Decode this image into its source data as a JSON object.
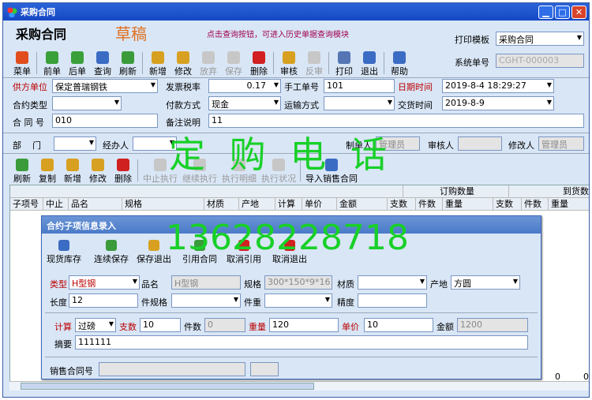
{
  "window": {
    "title": "采购合同"
  },
  "header": {
    "title": "采购合同",
    "draft": "草稿",
    "hint": "点击查询按钮，可进入历史单据查询模块",
    "print_template_label": "打印模板",
    "print_template_value": "采购合同",
    "sysno_label": "系统单号",
    "sysno_value": "CGHT-000003"
  },
  "toolbar": [
    {
      "label": "菜单",
      "icon": "menu-icon",
      "color": "#e24d1e",
      "enabled": true
    },
    {
      "label": "前单",
      "icon": "prev-record-icon",
      "color": "#3aa03a",
      "enabled": true
    },
    {
      "label": "后单",
      "icon": "next-record-icon",
      "color": "#3aa03a",
      "enabled": true
    },
    {
      "label": "查询",
      "icon": "search-icon",
      "color": "#3b6cc4",
      "enabled": true
    },
    {
      "label": "刷新",
      "icon": "refresh-icon",
      "color": "#3b9b3b",
      "enabled": true
    },
    {
      "label": "新增",
      "icon": "new-icon",
      "color": "#d8a020",
      "enabled": true
    },
    {
      "label": "修改",
      "icon": "edit-icon",
      "color": "#d8a020",
      "enabled": true
    },
    {
      "label": "放弃",
      "icon": "discard-icon",
      "color": "#8fb88f",
      "enabled": false
    },
    {
      "label": "保存",
      "icon": "save-icon",
      "color": "#d8c060",
      "enabled": false
    },
    {
      "label": "删除",
      "icon": "delete-icon",
      "color": "#d02020",
      "enabled": true
    },
    {
      "label": "审核",
      "icon": "lock-icon",
      "color": "#d8a020",
      "enabled": true
    },
    {
      "label": "反审",
      "icon": "unlock-icon",
      "color": "#d8a020",
      "enabled": false
    },
    {
      "label": "打印",
      "icon": "print-icon",
      "color": "#5575b5",
      "enabled": true
    },
    {
      "label": "退出",
      "icon": "exit-icon",
      "color": "#3b6cc4",
      "enabled": true
    },
    {
      "label": "帮助",
      "icon": "help-icon",
      "color": "#3b6cc4",
      "enabled": true
    }
  ],
  "form": {
    "supplier_label": "供方单位",
    "supplier_value": "保定普瑞钢铁",
    "invoice_tax_label": "发票税率",
    "invoice_tax_value": "0.17",
    "manual_no_label": "手工单号",
    "manual_no_value": "101",
    "datetime_label": "日期时间",
    "datetime_value": "2019-8-4 18:29:27",
    "contract_type_label": "合约类型",
    "contract_type_value": "",
    "pay_method_label": "付款方式",
    "pay_method_value": "现金",
    "transport_label": "运输方式",
    "transport_value": "",
    "delivery_label": "交货时间",
    "delivery_value": "2019-8-9",
    "contract_no_label": "合 同 号",
    "contract_no_value": "010",
    "remark_label": "备注说明",
    "remark_value": "11",
    "dept_label": "部    门",
    "dept_value": "",
    "handler_label": "经办人",
    "handler_value": "",
    "maker_label": "制单人",
    "maker_value": "管理员",
    "auditor_label": "审核人",
    "auditor_value": "",
    "modifier_label": "修改人",
    "modifier_value": "管理员"
  },
  "detail_toolbar": [
    {
      "label": "刷新",
      "icon": "refresh-icon",
      "enabled": true
    },
    {
      "label": "复制",
      "icon": "copy-icon",
      "enabled": true
    },
    {
      "label": "新增",
      "icon": "new-icon",
      "enabled": true
    },
    {
      "label": "修改",
      "icon": "edit-icon",
      "enabled": true
    },
    {
      "label": "删除",
      "icon": "delete-icon",
      "enabled": true
    },
    {
      "label": "中止执行",
      "icon": "stop-icon",
      "enabled": false
    },
    {
      "label": "继续执行",
      "icon": "continue-icon",
      "enabled": false
    },
    {
      "label": "执行明细",
      "icon": "detail-icon",
      "enabled": false
    },
    {
      "label": "执行状况",
      "icon": "status-icon",
      "enabled": false
    },
    {
      "label": "导入销售合同",
      "icon": "import-icon",
      "enabled": true
    }
  ],
  "grid": {
    "group_ordered": "订购数量",
    "group_arrived": "到货数",
    "columns": [
      "子项号",
      "中止",
      "品名",
      "规格",
      "材质",
      "产地",
      "计算",
      "单价",
      "金额",
      "支数",
      "件数",
      "重量",
      "支数",
      "件数",
      "重量"
    ],
    "footer_values": [
      "0",
      "0"
    ]
  },
  "dialog": {
    "title": "合约子项信息录入",
    "toolbar": [
      {
        "label": "现货库存",
        "icon": "search-icon"
      },
      {
        "label": "连续保存",
        "icon": "save-continue-icon"
      },
      {
        "label": "保存退出",
        "icon": "save-exit-icon"
      },
      {
        "label": "引用合同",
        "icon": "ref-contract-icon"
      },
      {
        "label": "取消引用",
        "icon": "cancel-ref-icon"
      },
      {
        "label": "取消退出",
        "icon": "cancel-exit-icon"
      }
    ],
    "type_label": "类型",
    "type_value": "H型钢",
    "name_label": "品名",
    "name_value": "H型钢",
    "spec_label": "规格",
    "spec_value": "300*150*9*16",
    "material_label": "材质",
    "material_value": "",
    "origin_label": "产地",
    "origin_value": "方圆",
    "length_label": "长度",
    "length_value": "12",
    "piece_spec_label": "件规格",
    "piece_spec_value": "",
    "piece_weight_label": "件重",
    "piece_weight_value": "",
    "precision_label": "精度",
    "precision_value": "",
    "calc_label": "计算",
    "calc_value": "过磅",
    "count_label": "支数",
    "count_value": "10",
    "pieces_label": "件数",
    "pieces_value": "0",
    "weight_label": "重量",
    "weight_value": "120",
    "price_label": "单价",
    "price_value": "10",
    "amount_label": "金额",
    "amount_value": "1200",
    "summary_label": "摘要",
    "summary_value": "111111",
    "sales_no_label": "销售合同号",
    "sales_no_value": ""
  },
  "watermark": {
    "line1": "定 购 电 话",
    "line2": "13628228718",
    "color": "#18d028"
  }
}
